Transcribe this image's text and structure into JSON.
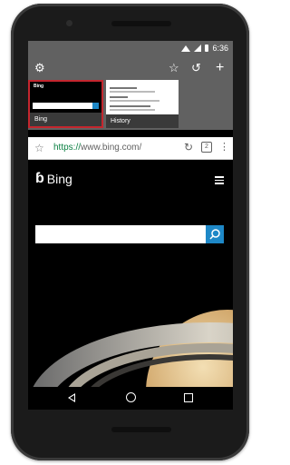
{
  "status_bar": {
    "time": "6:36"
  },
  "tab_switcher": {
    "settings_icon": "gear-icon",
    "bookmark_icon": "star-outline-icon",
    "history_icon": "history-icon",
    "new_tab_icon": "plus-icon",
    "tabs": [
      {
        "label": "Bing",
        "selected": true
      },
      {
        "label": "History",
        "selected": false
      }
    ]
  },
  "url_bar": {
    "scheme": "https://",
    "url": "www.bing.com/",
    "tab_count": "2",
    "bookmark_icon": "star-outline-icon",
    "refresh_icon": "refresh-icon",
    "menu_icon": "kebab-menu-icon"
  },
  "page": {
    "logo": "Bing",
    "menu_icon": "hamburger-icon",
    "search_placeholder": "",
    "search_icon": "search-icon",
    "accent": "#1e88c7"
  },
  "nav_bar": {
    "back_icon": "back-triangle-icon",
    "home_icon": "home-circle-icon",
    "recents_icon": "recents-square-icon"
  },
  "colors": {
    "selected_tab_border": "#c4262e",
    "toolbar": "#616161",
    "secure_url": "#0b8043"
  }
}
